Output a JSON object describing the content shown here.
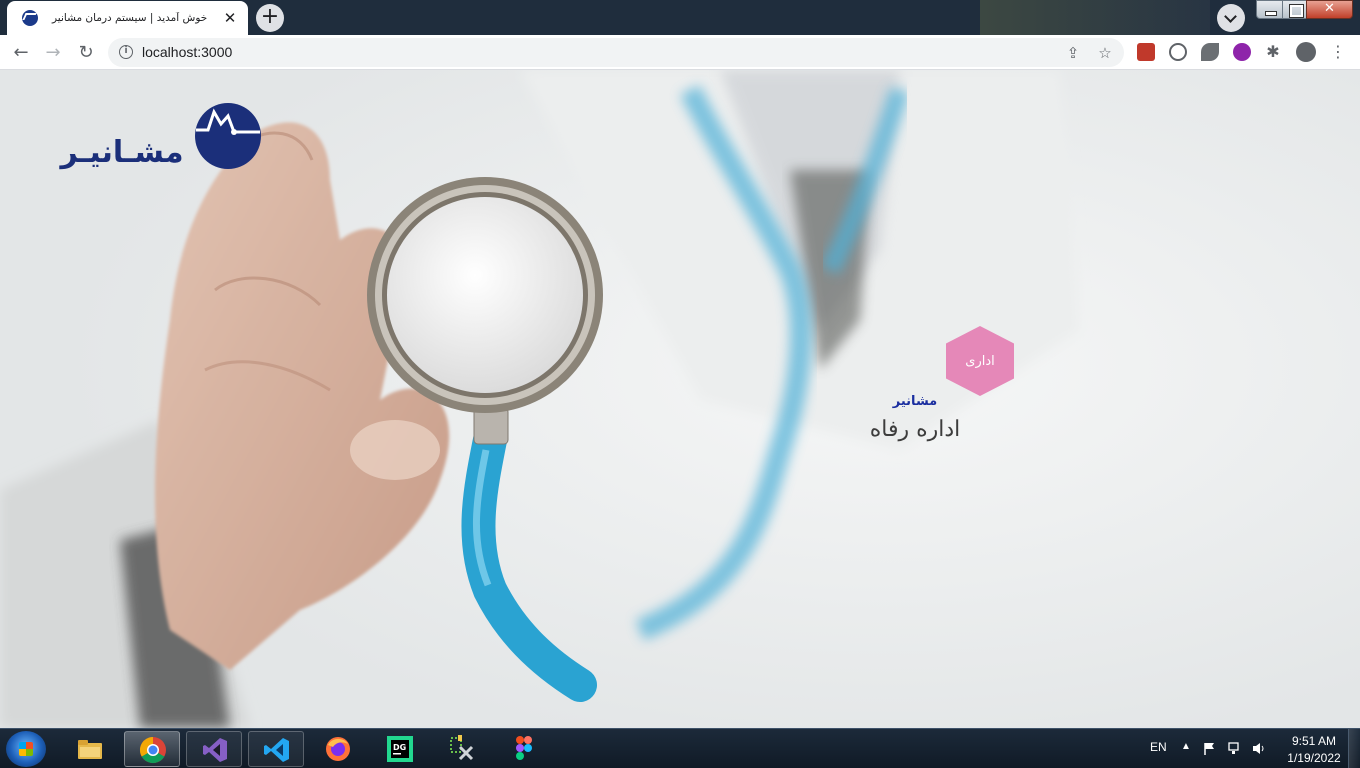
{
  "browser": {
    "tab_title": "خوش آمدید | سیستم درمان مشانیر",
    "tab_close": "✕",
    "new_tab": "+",
    "url": "localhost:3000",
    "info": "i",
    "back": "←",
    "forward": "→",
    "reload": "↻",
    "share": "⇪",
    "bookmark": "☆",
    "puzzle": "✱",
    "menu": "⋮"
  },
  "page": {
    "logo_text": "مشـانیـر",
    "role_label": "اداری",
    "brand_small": "مشانیر",
    "department_name": "اداره رفاه",
    "colors": {
      "brand_navy": "#1b2f7a",
      "role_pink": "#e588b8"
    }
  },
  "taskbar": {
    "apps": [
      {
        "name": "file-explorer-icon"
      },
      {
        "name": "chrome-icon"
      },
      {
        "name": "visual-studio-icon"
      },
      {
        "name": "vscode-icon"
      },
      {
        "name": "firefox-icon"
      },
      {
        "name": "datagrip-icon"
      },
      {
        "name": "build-tools-icon"
      },
      {
        "name": "figma-icon"
      }
    ],
    "language": "EN",
    "tray_arrow": "▲",
    "time": "9:51 AM",
    "date": "1/19/2022"
  }
}
